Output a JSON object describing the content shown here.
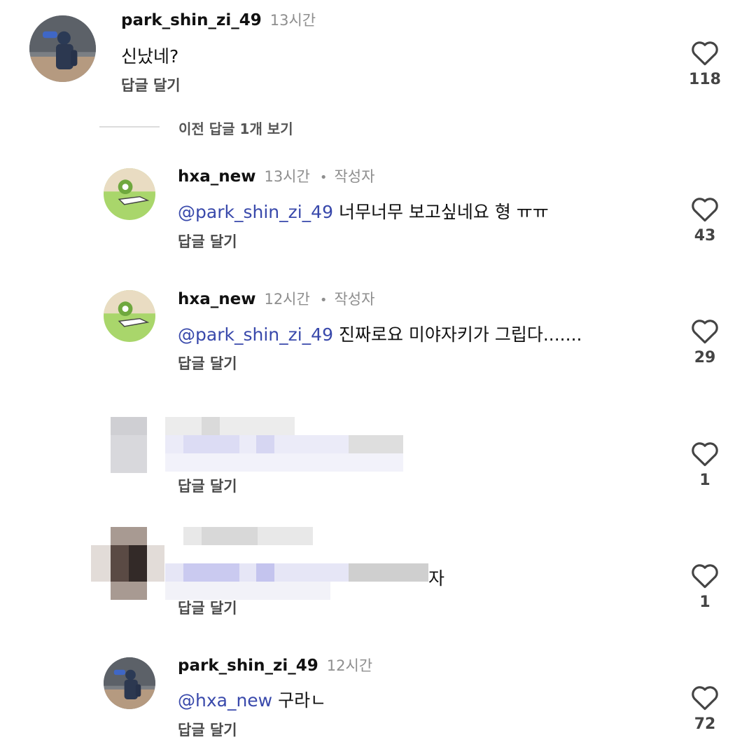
{
  "comments": [
    {
      "username": "park_shin_zi_49",
      "time": "13시간",
      "text": "신났네?",
      "reply": "답글 달기",
      "likes": "118"
    }
  ],
  "view_previous": "이전 답글 1개 보기",
  "replies": [
    {
      "username": "hxa_new",
      "time": "13시간",
      "dot": "•",
      "author": "작성자",
      "mention": "@park_shin_zi_49",
      "text": " 너무너무 보고싶네요 형 ㅠㅠ",
      "reply": "답글 달기",
      "likes": "43"
    },
    {
      "username": "hxa_new",
      "time": "12시간",
      "dot": "•",
      "author": "작성자",
      "mention": "@park_shin_zi_49",
      "text": " 진짜로요 미야자키가 그립다.......",
      "reply": "답글 달기",
      "likes": "29"
    },
    {
      "reply": "답글 달기",
      "likes": "1"
    },
    {
      "text_tail": "자",
      "reply": "답글 달기",
      "likes": "1"
    },
    {
      "username": "park_shin_zi_49",
      "time": "12시간",
      "mention": "@hxa_new",
      "text": " 구라ㄴ",
      "reply": "답글 달기",
      "likes": "72"
    }
  ],
  "colors": {
    "mention": "#3949ab",
    "meta": "#8e8e8e",
    "divider": "#dcdcdc"
  }
}
